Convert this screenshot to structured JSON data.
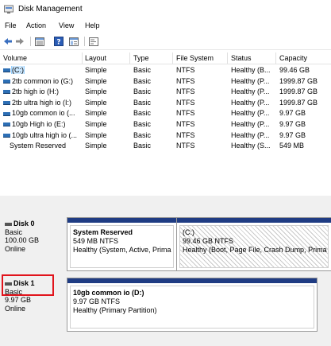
{
  "window": {
    "title": "Disk Management"
  },
  "menu": [
    "File",
    "Action",
    "View",
    "Help"
  ],
  "toolbar": [
    "back-icon",
    "forward-icon",
    "list-view-icon",
    "help-icon",
    "properties-icon",
    "console-icon"
  ],
  "columns": [
    "Volume",
    "Layout",
    "Type",
    "File System",
    "Status",
    "Capacity"
  ],
  "volumes": [
    {
      "name": "(C:)",
      "layout": "Simple",
      "type": "Basic",
      "fs": "NTFS",
      "status": "Healthy (B...",
      "capacity": "99.46 GB"
    },
    {
      "name": "2tb common io (G:)",
      "layout": "Simple",
      "type": "Basic",
      "fs": "NTFS",
      "status": "Healthy (P...",
      "capacity": "1999.87 GB"
    },
    {
      "name": "2tb high io (H:)",
      "layout": "Simple",
      "type": "Basic",
      "fs": "NTFS",
      "status": "Healthy (P...",
      "capacity": "1999.87 GB"
    },
    {
      "name": "2tb ultra high io (I:)",
      "layout": "Simple",
      "type": "Basic",
      "fs": "NTFS",
      "status": "Healthy (P...",
      "capacity": "1999.87 GB"
    },
    {
      "name": "10gb common io (...",
      "layout": "Simple",
      "type": "Basic",
      "fs": "NTFS",
      "status": "Healthy (P...",
      "capacity": "9.97 GB"
    },
    {
      "name": "10gb High io (E:)",
      "layout": "Simple",
      "type": "Basic",
      "fs": "NTFS",
      "status": "Healthy (P...",
      "capacity": "9.97 GB"
    },
    {
      "name": "10gb ultra high io (...",
      "layout": "Simple",
      "type": "Basic",
      "fs": "NTFS",
      "status": "Healthy (P...",
      "capacity": "9.97 GB"
    },
    {
      "name": "System Reserved",
      "layout": "Simple",
      "type": "Basic",
      "fs": "NTFS",
      "status": "Healthy (S...",
      "capacity": "549 MB"
    }
  ],
  "disks": [
    {
      "name": "Disk 0",
      "type": "Basic",
      "size": "100.00 GB",
      "status": "Online",
      "partitions": [
        {
          "name": "System Reserved",
          "size": "549 MB NTFS",
          "status": "Healthy (System, Active, Prima"
        },
        {
          "name": "(C:)",
          "size": "99.46 GB NTFS",
          "status": "Healthy (Boot, Page File, Crash Dump, Prima"
        }
      ]
    },
    {
      "name": "Disk 1",
      "type": "Basic",
      "size": "9.97 GB",
      "status": "Online",
      "partitions": [
        {
          "name": "10gb common io  (D:)",
          "size": "9.97 GB NTFS",
          "status": "Healthy (Primary Partition)"
        }
      ]
    }
  ],
  "colors": {
    "partition_bar": "#1f3c83",
    "highlight": "#e1141c",
    "selected_row": "#cce8ff"
  }
}
